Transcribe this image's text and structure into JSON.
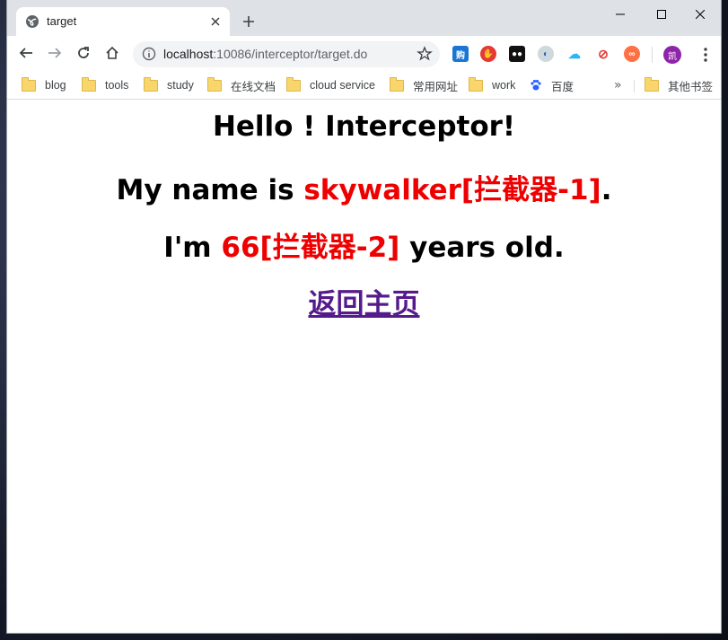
{
  "tab": {
    "title": "target"
  },
  "omnibox": {
    "host": "localhost",
    "rest": ":10086/interceptor/target.do"
  },
  "bookmarks": [
    {
      "label": "blog"
    },
    {
      "label": "tools"
    },
    {
      "label": "study"
    },
    {
      "label": "在线文档"
    },
    {
      "label": "cloud service"
    },
    {
      "label": "常用网址"
    },
    {
      "label": "work"
    },
    {
      "label": "百度"
    }
  ],
  "bookmarks_more": "»",
  "other_bookmarks": "其他书签",
  "avatar_letter": "凯",
  "page": {
    "heading": "Hello ! Interceptor!",
    "name_prefix": "My name is ",
    "name_value": "skywalker[拦截器-1]",
    "name_suffix": ".",
    "age_prefix": "I'm ",
    "age_value": "66[拦截器-2]",
    "age_suffix": " years old.",
    "home_link": "返回主页"
  },
  "colors": {
    "accent_red": "#ee0000",
    "link": "#551a8b"
  },
  "icons": [
    "globe-icon",
    "close-icon",
    "plus-icon",
    "minimize-icon",
    "maximize-icon",
    "window-close-icon",
    "back-icon",
    "forward-icon",
    "reload-icon",
    "home-icon",
    "info-icon",
    "star-icon",
    "menu-dots-icon",
    "folder-icon",
    "paw-icon"
  ]
}
